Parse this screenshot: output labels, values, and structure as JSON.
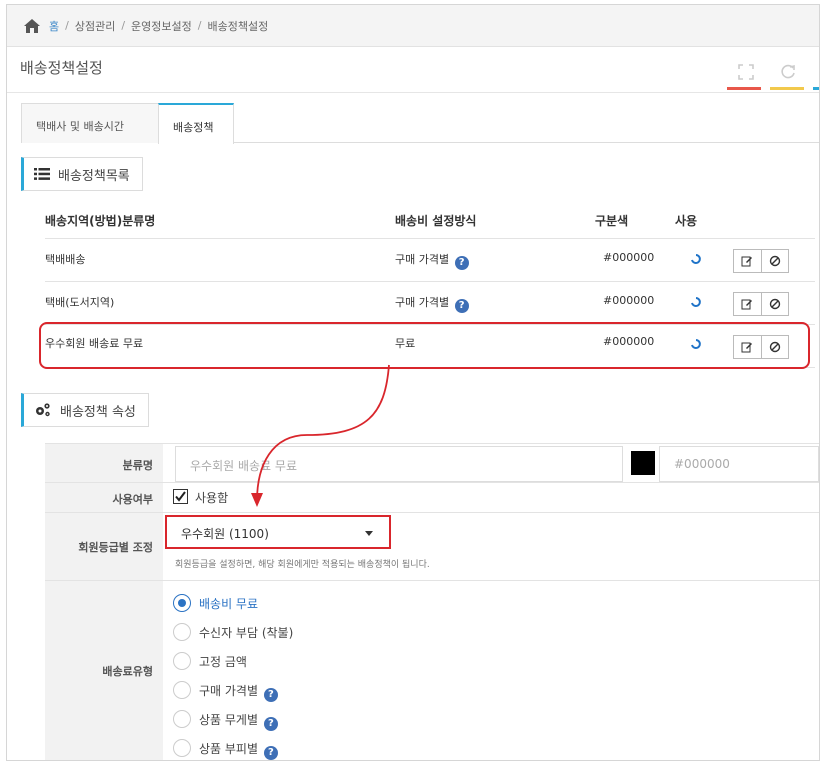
{
  "breadcrumb": {
    "home": "홈",
    "items": [
      "상점관리",
      "운영정보설정",
      "배송정책설정"
    ]
  },
  "page": {
    "title": "배송정책설정"
  },
  "tabs": [
    {
      "label": "택배사 및 배송시간",
      "active": false
    },
    {
      "label": "배송정책",
      "active": true
    }
  ],
  "list_section": {
    "heading": "배송정책목록",
    "columns": [
      "배송지역(방법)분류명",
      "배송비 설정방식",
      "구분색",
      "사용"
    ],
    "rows": [
      {
        "name": "택배배송",
        "method": "구매 가격별",
        "help": true,
        "color": "#000000"
      },
      {
        "name": "택배(도서지역)",
        "method": "구매 가격별",
        "help": true,
        "color": "#000000"
      },
      {
        "name": "우수회원 배송료 무료",
        "method": "무료",
        "help": false,
        "color": "#000000"
      }
    ]
  },
  "attr_section": {
    "heading": "배송정책 속성",
    "name_label": "분류명",
    "name_placeholder": "우수회원 배송료 무료",
    "color_value": "#000000",
    "use_label": "사용여부",
    "use_checkbox_label": "사용함",
    "grade_label": "회원등급별 조정",
    "grade_selected": "우수회원 (1100)",
    "grade_help": "회원등급을 설정하면, 해당 회원에게만 적용되는 배송정책이 됩니다.",
    "fee_type_label": "배송료유형",
    "fee_options": [
      {
        "label": "배송비 무료",
        "selected": true,
        "help": false
      },
      {
        "label": "수신자 부담 (착불)",
        "selected": false,
        "help": false
      },
      {
        "label": "고정 금액",
        "selected": false,
        "help": false
      },
      {
        "label": "구매 가격별",
        "selected": false,
        "help": true
      },
      {
        "label": "상품 무게별",
        "selected": false,
        "help": true
      },
      {
        "label": "상품 부피별",
        "selected": false,
        "help": true
      }
    ]
  },
  "colors": {
    "accent": "#2aa8d8",
    "highlight": "#d9262c",
    "link": "#3a86c8",
    "tab_underline": [
      "#e8574a",
      "#f2c94c",
      "#2aa8d8"
    ]
  },
  "help_glyph": "?"
}
